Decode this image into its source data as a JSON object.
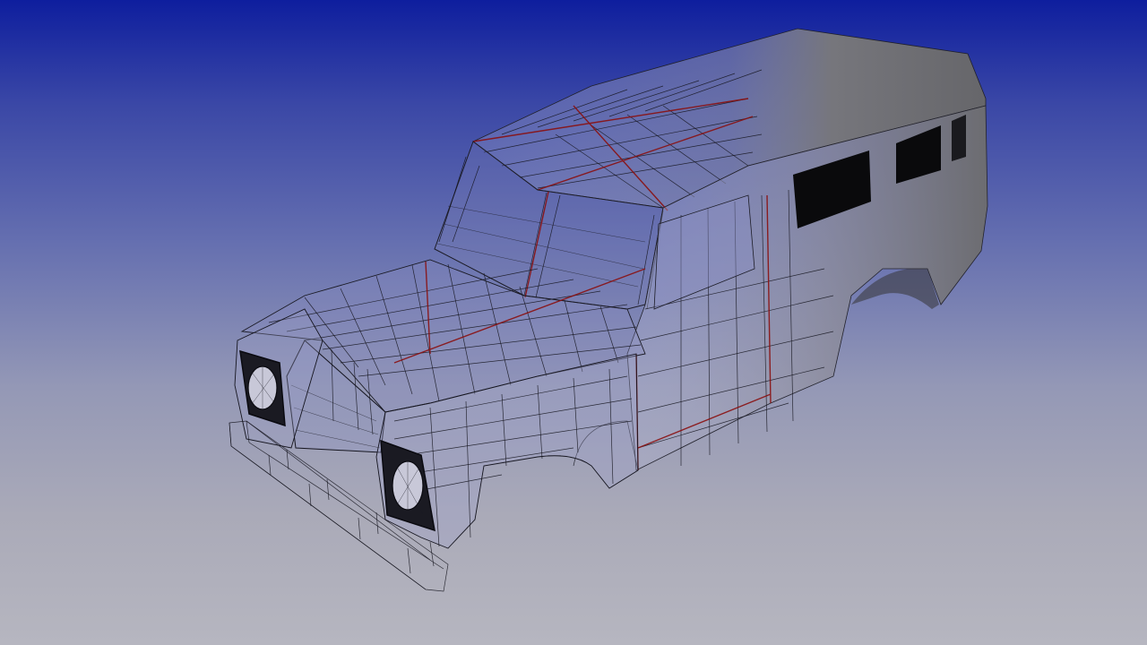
{
  "viewport": {
    "background_top": "#0e1e9e",
    "background_bottom": "#b6b6c0",
    "wire_color": "#15151f",
    "seam_color": "#8a1010",
    "solid_shading": "#6a6a70"
  },
  "model": {
    "object": "vehicle-body-shell",
    "display_mode": "wireframe-to-shaded-blend",
    "parts": [
      "roof",
      "windscreen-frame",
      "bonnet",
      "front-grille",
      "headlamps",
      "front-fenders",
      "side-windows",
      "bumper"
    ]
  }
}
